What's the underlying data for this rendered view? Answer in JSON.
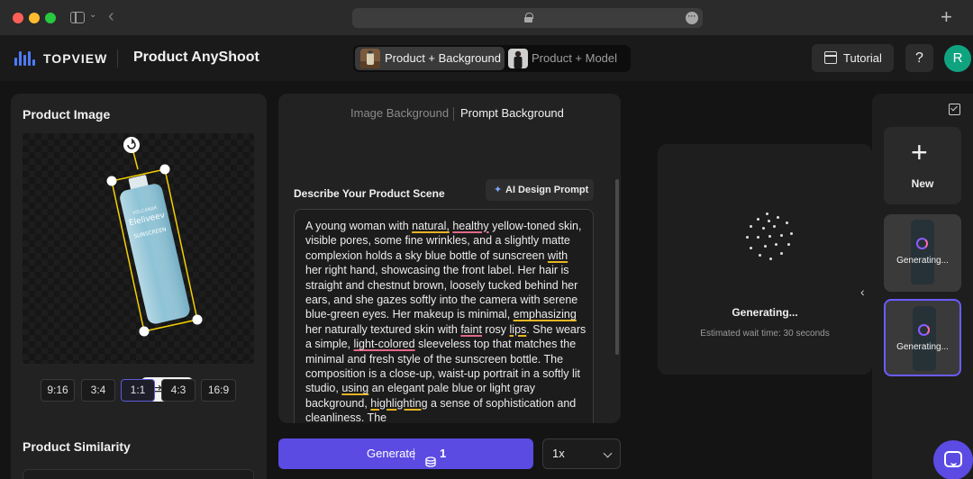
{
  "header": {
    "brand": "TOPVIEW",
    "app_title": "Product AnyShoot",
    "modes": [
      {
        "label": "Product + Background",
        "active": true
      },
      {
        "label": "Product + Model",
        "active": false
      }
    ],
    "tutorial_label": "Tutorial",
    "help_label": "?",
    "avatar_initial": "R"
  },
  "product_image": {
    "title": "Product Image",
    "ratios": [
      "9:16",
      "3:4",
      "1:1",
      "4:3",
      "16:9"
    ],
    "selected_ratio": "1:1",
    "product_text": {
      "top": "VOLCANAR",
      "brand": "Eleliveev",
      "name": "SUNSCREEN"
    }
  },
  "product_similarity": {
    "title": "Product Similarity"
  },
  "scene": {
    "tabs": [
      {
        "label": "Image Background",
        "active": false
      },
      {
        "label": "Prompt Background",
        "active": true
      }
    ],
    "label": "Describe Your Product Scene",
    "ai_button_label": "AI Design Prompt",
    "prompt_segments": [
      {
        "t": "A young woman with ",
        "u": ""
      },
      {
        "t": "natural,",
        "u": "y"
      },
      {
        "t": " ",
        "u": ""
      },
      {
        "t": "healthy",
        "u": "p"
      },
      {
        "t": " yellow-toned skin, visible pores, some fine wrinkles, and a slightly matte complexion holds a sky blue bottle of sunscreen ",
        "u": ""
      },
      {
        "t": "with",
        "u": "y"
      },
      {
        "t": " her right hand, showcasing the front label. Her hair is straight and chestnut brown, loosely tucked behind her ears, and she gazes softly into the camera with serene blue-green eyes. Her makeup is minimal, ",
        "u": ""
      },
      {
        "t": "emphasizing",
        "u": "y"
      },
      {
        "t": " her naturally textured skin with ",
        "u": ""
      },
      {
        "t": "faint",
        "u": "p"
      },
      {
        "t": " rosy ",
        "u": ""
      },
      {
        "t": "lips",
        "u": "y"
      },
      {
        "t": ". She wears a simple, ",
        "u": ""
      },
      {
        "t": "light-colored",
        "u": "p"
      },
      {
        "t": " sleeveless top that matches the minimal and fresh style of the sunscreen bottle. The composition is a close-up, waist-up portrait in a softly lit studio, ",
        "u": ""
      },
      {
        "t": "using",
        "u": "y"
      },
      {
        "t": " an elegant pale blue or light gray background, ",
        "u": ""
      },
      {
        "t": "highlighting",
        "u": "y"
      },
      {
        "t": " a sense of sophistication and cleanliness. The",
        "u": ""
      }
    ]
  },
  "actions": {
    "generate_label": "Generate",
    "credit_cost": "1",
    "quantity": "1x"
  },
  "preview": {
    "status": "Generating...",
    "wait_text": "Estimated wait time: 30 seconds"
  },
  "history": {
    "new_label": "New",
    "jobs": [
      {
        "label": "Generating...",
        "selected": false
      },
      {
        "label": "Generating...",
        "selected": true
      }
    ]
  },
  "colors": {
    "accent": "#5b4be2",
    "selection_border": "#6a5cff",
    "avatar": "#10a37f",
    "brand_blue": "#4d7bff",
    "underline_grammar": "#e6b422",
    "underline_spelling": "#e06888"
  }
}
